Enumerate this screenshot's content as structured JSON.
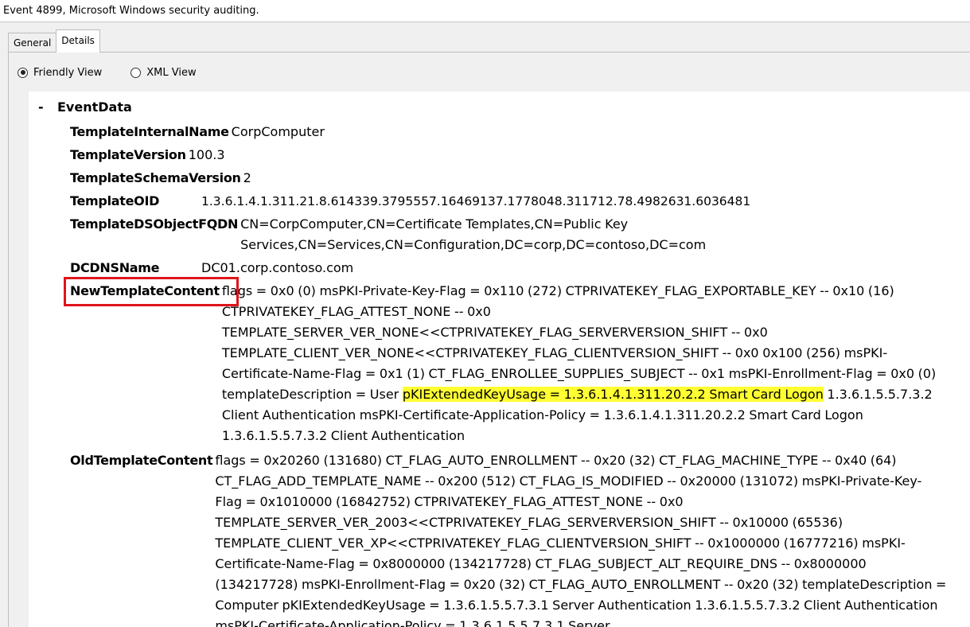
{
  "window": {
    "title": "Event 4899, Microsoft Windows security auditing."
  },
  "tabs": [
    {
      "label": "General"
    },
    {
      "label": "Details"
    }
  ],
  "views": {
    "friendly": "Friendly View",
    "xml": "XML View"
  },
  "event": {
    "section": "EventData",
    "collapse_symbol": "-",
    "fields": {
      "TemplateInternalName": {
        "key": "TemplateInternalName",
        "value": "CorpComputer"
      },
      "TemplateVersion": {
        "key": "TemplateVersion",
        "value": "100.3"
      },
      "TemplateSchemaVersion": {
        "key": "TemplateSchemaVersion",
        "value": "2"
      },
      "TemplateOID": {
        "key": "TemplateOID",
        "value": "1.3.6.1.4.1.311.21.8.614339.3795557.16469137.1778048.311712.78.4982631.6036481"
      },
      "TemplateDSObjectFQDN": {
        "key": "TemplateDSObjectFQDN",
        "value": "CN=CorpComputer,CN=Certificate Templates,CN=Public Key Services,CN=Services,CN=Configuration,DC=corp,DC=contoso,DC=com"
      },
      "DCDNSName": {
        "key": "DCDNSName",
        "value": "DC01.corp.contoso.com"
      },
      "NewTemplateContent": {
        "key": "NewTemplateContent",
        "value_before": "flags = 0x0 (0) msPKI-Private-Key-Flag = 0x110 (272) CTPRIVATEKEY_FLAG_EXPORTABLE_KEY -- 0x10 (16) CTPRIVATEKEY_FLAG_ATTEST_NONE -- 0x0 TEMPLATE_SERVER_VER_NONE<<CTPRIVATEKEY_FLAG_SERVERVERSION_SHIFT -- 0x0 TEMPLATE_CLIENT_VER_NONE<<CTPRIVATEKEY_FLAG_CLIENTVERSION_SHIFT -- 0x0 0x100 (256) msPKI-Certificate-Name-Flag = 0x1 (1) CT_FLAG_ENROLLEE_SUPPLIES_SUBJECT -- 0x1 msPKI-Enrollment-Flag = 0x0 (0) templateDescription = User ",
        "value_highlight": "pKIExtendedKeyUsage = 1.3.6.1.4.1.311.20.2.2 Smart Card Logon",
        "value_after": " 1.3.6.1.5.5.7.3.2 Client Authentication msPKI-Certificate-Application-Policy = 1.3.6.1.4.1.311.20.2.2 Smart Card Logon 1.3.6.1.5.5.7.3.2 Client Authentication"
      },
      "OldTemplateContent": {
        "key": "OldTemplateContent",
        "value": "flags = 0x20260 (131680) CT_FLAG_AUTO_ENROLLMENT -- 0x20 (32) CT_FLAG_MACHINE_TYPE -- 0x40 (64) CT_FLAG_ADD_TEMPLATE_NAME -- 0x200 (512) CT_FLAG_IS_MODIFIED -- 0x20000 (131072) msPKI-Private-Key-Flag = 0x1010000 (16842752) CTPRIVATEKEY_FLAG_ATTEST_NONE -- 0x0 TEMPLATE_SERVER_VER_2003<<CTPRIVATEKEY_FLAG_SERVERVERSION_SHIFT -- 0x10000 (65536) TEMPLATE_CLIENT_VER_XP<<CTPRIVATEKEY_FLAG_CLIENTVERSION_SHIFT -- 0x1000000 (16777216) msPKI-Certificate-Name-Flag = 0x8000000 (134217728) CT_FLAG_SUBJECT_ALT_REQUIRE_DNS -- 0x8000000 (134217728) msPKI-Enrollment-Flag = 0x20 (32) CT_FLAG_AUTO_ENROLLMENT -- 0x20 (32) templateDescription = Computer pKIExtendedKeyUsage = 1.3.6.1.5.5.7.3.1 Server Authentication 1.3.6.1.5.5.7.3.2 Client Authentication msPKI-Certificate-Application-Policy = 1.3.6.1.5.5.7.3.1 Server"
      }
    }
  },
  "colors": {
    "highlight": "#ffff32",
    "annotation_box": "#e0141b"
  }
}
